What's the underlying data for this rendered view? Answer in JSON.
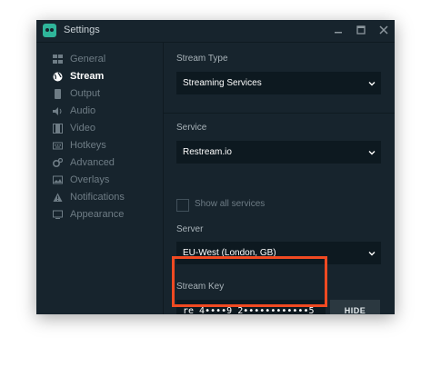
{
  "window": {
    "title": "Settings",
    "icon": "streamlabs-logo-icon",
    "controls": [
      "minimize-icon",
      "maximize-icon",
      "close-icon"
    ]
  },
  "sidebar": {
    "items": [
      {
        "label": "General",
        "icon": "grid-icon",
        "active": false
      },
      {
        "label": "Stream",
        "icon": "globe-icon",
        "active": true
      },
      {
        "label": "Output",
        "icon": "output-icon",
        "active": false
      },
      {
        "label": "Audio",
        "icon": "speaker-icon",
        "active": false
      },
      {
        "label": "Video",
        "icon": "film-icon",
        "active": false
      },
      {
        "label": "Hotkeys",
        "icon": "keyboard-icon",
        "active": false
      },
      {
        "label": "Advanced",
        "icon": "gears-icon",
        "active": false
      },
      {
        "label": "Overlays",
        "icon": "overlay-icon",
        "active": false
      },
      {
        "label": "Notifications",
        "icon": "warning-icon",
        "active": false
      },
      {
        "label": "Appearance",
        "icon": "monitor-icon",
        "active": false
      }
    ]
  },
  "stream": {
    "stream_type_label": "Stream Type",
    "stream_type_value": "Streaming Services",
    "service_label": "Service",
    "service_value": "Restream.io",
    "show_all_label": "Show all services",
    "show_all_checked": false,
    "server_label": "Server",
    "server_value": "EU-West (London, GB)",
    "stream_key_label": "Stream Key",
    "stream_key_value": "re_4••••9_2••••••••••••5",
    "hide_button": "HIDE"
  },
  "colors": {
    "background": "#17242d",
    "input_background": "#0d1920",
    "highlight_border": "#f04a22",
    "brand": "#2fb59a"
  }
}
